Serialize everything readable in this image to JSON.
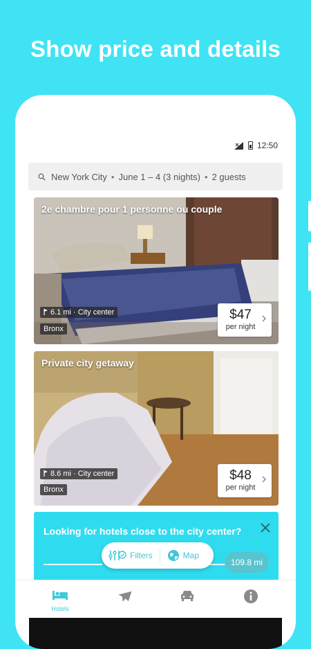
{
  "headline": "Show price and details",
  "status_bar": {
    "time": "12:50"
  },
  "search": {
    "city": "New York City",
    "dates": "June 1 – 4 (3 nights)",
    "guests": "2 guests",
    "separator": "•"
  },
  "listings": [
    {
      "title": "2e chambre pour 1 personne ou couple",
      "distance": "6.1 mi · City center",
      "borough": "Bronx",
      "price": "$47",
      "per": "per night"
    },
    {
      "title": "Private city getaway",
      "distance": "8.6 mi · City center",
      "borough": "Bronx",
      "price": "$48",
      "per": "per night"
    }
  ],
  "promo": {
    "text": "Looking for hotels close to the city center?",
    "distance_badge": "109.8 mi"
  },
  "fab": {
    "filters": "Filters",
    "map": "Map"
  },
  "tabs": [
    {
      "icon": "bed-icon",
      "label": "Hotels",
      "active": true
    },
    {
      "icon": "airplane-icon",
      "label": "",
      "active": false
    },
    {
      "icon": "car-icon",
      "label": "",
      "active": false
    },
    {
      "icon": "info-icon",
      "label": "",
      "active": false
    }
  ],
  "colors": {
    "background": "#3FE3F4",
    "accent": "#3FC9DB",
    "promo": "#2FDCEF"
  }
}
